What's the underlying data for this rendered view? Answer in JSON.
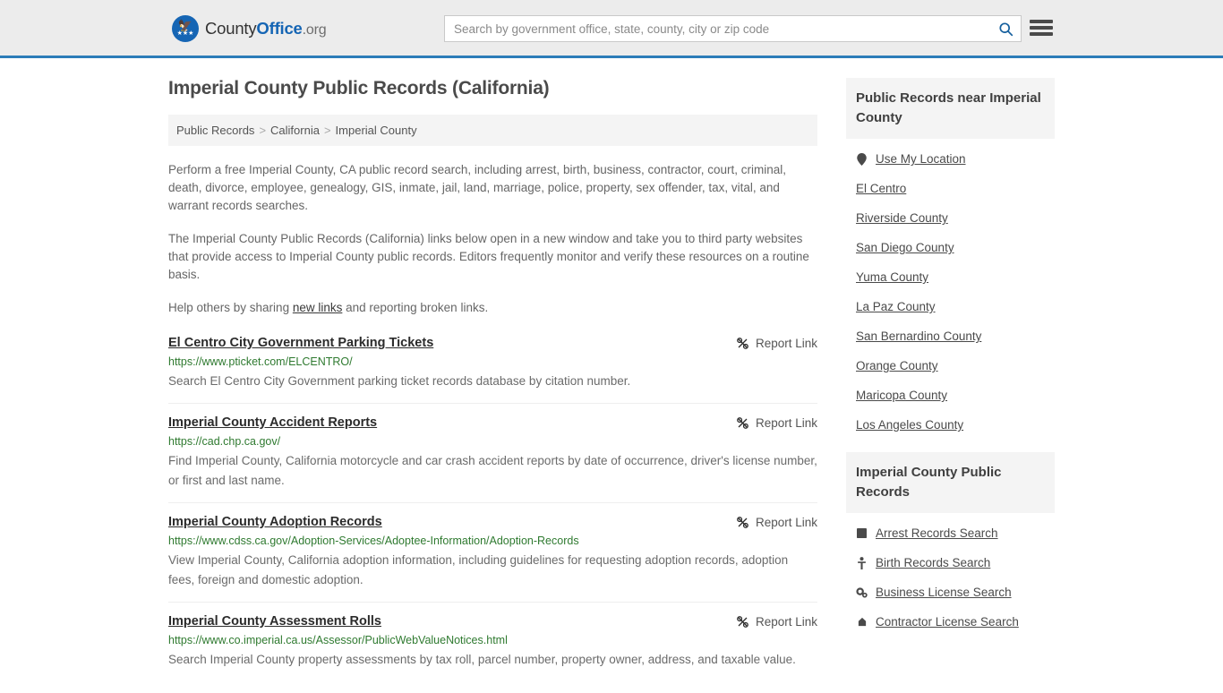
{
  "header": {
    "logo": {
      "part1": "County",
      "part2": "Office",
      "part3": ".org",
      "mark_icon": "eagle-stars-emblem"
    },
    "search": {
      "placeholder": "Search by government office, state, county, city or zip code",
      "value": "",
      "icon": "search-icon"
    },
    "menu_icon": "hamburger-menu-icon"
  },
  "main": {
    "title": "Imperial County Public Records (California)",
    "breadcrumb": [
      {
        "label": "Public Records"
      },
      {
        "label": "California"
      },
      {
        "label": "Imperial County"
      }
    ],
    "breadcrumb_separator": ">",
    "paragraphs": {
      "p1": "Perform a free Imperial County, CA public record search, including arrest, birth, business, contractor, court, criminal, death, divorce, employee, genealogy, GIS, inmate, jail, land, marriage, police, property, sex offender, tax, vital, and warrant records searches.",
      "p2": "The Imperial County Public Records (California) links below open in a new window and take you to third party websites that provide access to Imperial County public records. Editors frequently monitor and verify these resources on a routine basis.",
      "p3_before": "Help others by sharing ",
      "p3_link": "new links",
      "p3_after": " and reporting broken links."
    },
    "report_label": "Report Link",
    "report_icon": "broken-link-icon",
    "results": [
      {
        "title": "El Centro City Government Parking Tickets",
        "url": "https://www.pticket.com/ELCENTRO/",
        "description": "Search El Centro City Government parking ticket records database by citation number."
      },
      {
        "title": "Imperial County Accident Reports",
        "url": "https://cad.chp.ca.gov/",
        "description": "Find Imperial County, California motorcycle and car crash accident reports by date of occurrence, driver's license number, or first and last name."
      },
      {
        "title": "Imperial County Adoption Records",
        "url": "https://www.cdss.ca.gov/Adoption-Services/Adoptee-Information/Adoption-Records",
        "description": "View Imperial County, California adoption information, including guidelines for requesting adoption records, adoption fees, foreign and domestic adoption."
      },
      {
        "title": "Imperial County Assessment Rolls",
        "url": "https://www.co.imperial.ca.us/Assessor/PublicWebValueNotices.html",
        "description": "Search Imperial County property assessments by tax roll, parcel number, property owner, address, and taxable value."
      }
    ]
  },
  "sidebar": {
    "near_heading": "Public Records near Imperial County",
    "near_items": [
      {
        "label": "Use My Location",
        "icon": "map-pin-icon"
      },
      {
        "label": "El Centro",
        "icon": ""
      },
      {
        "label": "Riverside County",
        "icon": ""
      },
      {
        "label": "San Diego County",
        "icon": ""
      },
      {
        "label": "Yuma County",
        "icon": ""
      },
      {
        "label": "La Paz County",
        "icon": ""
      },
      {
        "label": "San Bernardino County",
        "icon": ""
      },
      {
        "label": "Orange County",
        "icon": ""
      },
      {
        "label": "Maricopa County",
        "icon": ""
      },
      {
        "label": "Los Angeles County",
        "icon": ""
      }
    ],
    "records_heading": "Imperial County Public Records",
    "records_items": [
      {
        "label": "Arrest Records Search",
        "icon": "fingerprint-icon"
      },
      {
        "label": "Birth Records Search",
        "icon": "baby-icon"
      },
      {
        "label": "Business License Search",
        "icon": "cogs-icon"
      },
      {
        "label": "Contractor License Search",
        "icon": "hard-hat-icon"
      }
    ]
  },
  "colors": {
    "header_bg": "#ececec",
    "header_border": "#2c7cb8",
    "brand_blue": "#1565b4",
    "url_green": "#2f7a30",
    "panel_gray": "#f4f4f4"
  }
}
